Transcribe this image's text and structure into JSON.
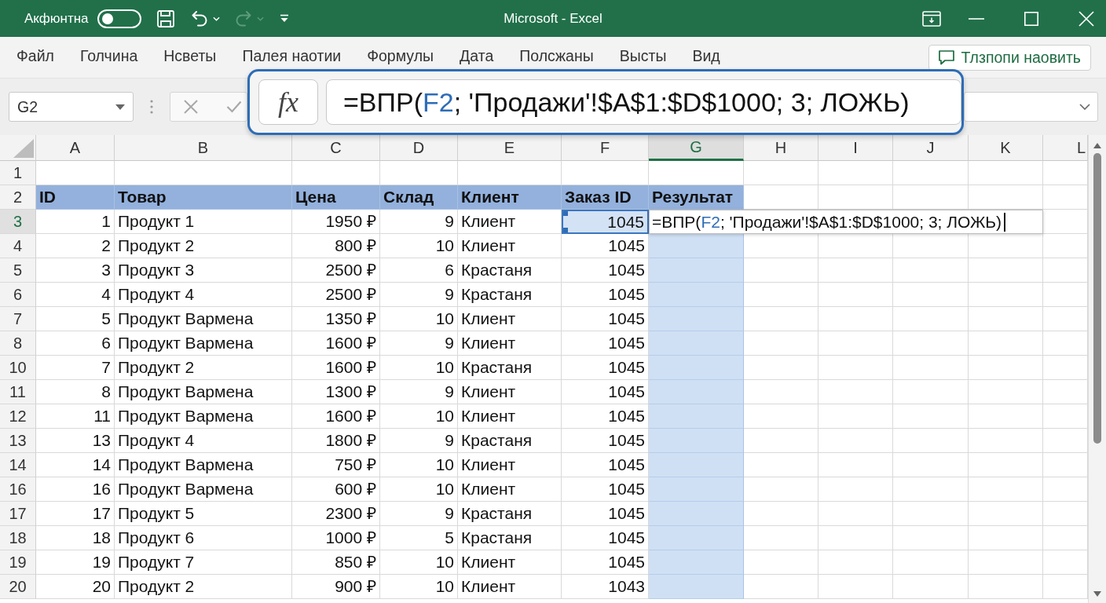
{
  "title_bar": {
    "toggle_label": "Акфюнтна",
    "toggle_on": false,
    "redo_disabled": true,
    "title": "Microsoft - Excel"
  },
  "ribbon_tabs": [
    {
      "label": "Файл",
      "selected": false
    },
    {
      "label": "Голчина",
      "selected": false
    },
    {
      "label": "Нсветы",
      "selected": false
    },
    {
      "label": "Палея наотии",
      "selected": false
    },
    {
      "label": "Формулы",
      "selected": false
    },
    {
      "label": "Дата",
      "selected": false
    },
    {
      "label": "Полсжаны",
      "selected": false
    },
    {
      "label": "Высты",
      "selected": false
    },
    {
      "label": "Вид",
      "selected": false
    }
  ],
  "comment_button": {
    "label": "Тлзпопи наовить"
  },
  "formula_bar": {
    "name_box": "G2",
    "fx_label": "fx",
    "formula": [
      {
        "text": "=ВПР(",
        "kind": "text"
      },
      {
        "text": "F2",
        "kind": "reference"
      },
      {
        "text": "; 'Продажи'!$A$1:$D$1000; 3; ЛОЖЬ)",
        "kind": "text"
      }
    ]
  },
  "sheet": {
    "columns": [
      {
        "label": "A",
        "selected": false
      },
      {
        "label": "B",
        "selected": false
      },
      {
        "label": "C",
        "selected": false
      },
      {
        "label": "D",
        "selected": false
      },
      {
        "label": "E",
        "selected": false
      },
      {
        "label": "F",
        "selected": false
      },
      {
        "label": "G",
        "selected": true
      },
      {
        "label": "H",
        "selected": false
      },
      {
        "label": "I",
        "selected": false
      },
      {
        "label": "J",
        "selected": false
      },
      {
        "label": "K",
        "selected": false
      },
      {
        "label": "L",
        "selected": false
      }
    ],
    "rows": [
      {
        "label": "1",
        "selected": false,
        "kind": "blank"
      },
      {
        "label": "2",
        "selected": false,
        "kind": "header",
        "cells": [
          {
            "text": "ID",
            "referenced": false
          },
          {
            "text": "Товар",
            "referenced": false
          },
          {
            "text": "Цена",
            "referenced": false
          },
          {
            "text": "Склад",
            "referenced": false
          },
          {
            "text": "Клиент",
            "referenced": false
          },
          {
            "text": "Заказ ID",
            "referenced": false
          },
          {
            "text": "Результат",
            "referenced": false
          }
        ]
      },
      {
        "label": "3",
        "selected": true,
        "kind": "data",
        "cells": [
          {
            "text": "1",
            "referenced": false
          },
          {
            "text": "Продукт 1",
            "referenced": false
          },
          {
            "text": "1950 ₽",
            "referenced": false
          },
          {
            "text": "9",
            "referenced": false
          },
          {
            "text": "Клиент",
            "referenced": false
          },
          {
            "text": "1045",
            "referenced": true
          }
        ],
        "editor": {
          "formula": [
            {
              "text": "=ВПР(",
              "kind": "text"
            },
            {
              "text": "F2",
              "kind": "reference"
            },
            {
              "text": "; 'Продажи'!$A$1:$D$1000; 3; ЛОЖЬ)",
              "kind": "text"
            }
          ]
        }
      },
      {
        "label": "4",
        "selected": false,
        "kind": "data",
        "cells": [
          {
            "text": "2",
            "referenced": false
          },
          {
            "text": "Продукт 2",
            "referenced": false
          },
          {
            "text": "800 ₽",
            "referenced": false
          },
          {
            "text": "10",
            "referenced": false
          },
          {
            "text": "Клиент",
            "referenced": false
          },
          {
            "text": "1045",
            "referenced": false
          }
        ]
      },
      {
        "label": "5",
        "selected": false,
        "kind": "data",
        "cells": [
          {
            "text": "3",
            "referenced": false
          },
          {
            "text": "Продукт 3",
            "referenced": false
          },
          {
            "text": "2500 ₽",
            "referenced": false
          },
          {
            "text": "6",
            "referenced": false
          },
          {
            "text": "Крастаня",
            "referenced": false
          },
          {
            "text": "1045",
            "referenced": false
          }
        ]
      },
      {
        "label": "6",
        "selected": false,
        "kind": "data",
        "cells": [
          {
            "text": "4",
            "referenced": false
          },
          {
            "text": "Продукт 4",
            "referenced": false
          },
          {
            "text": "2500 ₽",
            "referenced": false
          },
          {
            "text": "9",
            "referenced": false
          },
          {
            "text": "Крастаня",
            "referenced": false
          },
          {
            "text": "1045",
            "referenced": false
          }
        ]
      },
      {
        "label": "7",
        "selected": false,
        "kind": "data",
        "cells": [
          {
            "text": "5",
            "referenced": false
          },
          {
            "text": "Продукт Вармена",
            "referenced": false
          },
          {
            "text": "1350 ₽",
            "referenced": false
          },
          {
            "text": "10",
            "referenced": false
          },
          {
            "text": "Клиент",
            "referenced": false
          },
          {
            "text": "1045",
            "referenced": false
          }
        ]
      },
      {
        "label": "8",
        "selected": false,
        "kind": "data",
        "cells": [
          {
            "text": "6",
            "referenced": false
          },
          {
            "text": "Продукт Вармена",
            "referenced": false
          },
          {
            "text": "1600 ₽",
            "referenced": false
          },
          {
            "text": "9",
            "referenced": false
          },
          {
            "text": "Клиент",
            "referenced": false
          },
          {
            "text": "1045",
            "referenced": false
          }
        ]
      },
      {
        "label": "10",
        "selected": false,
        "kind": "data",
        "cells": [
          {
            "text": "7",
            "referenced": false
          },
          {
            "text": "Продукт 2",
            "referenced": false
          },
          {
            "text": "1600 ₽",
            "referenced": false
          },
          {
            "text": "10",
            "referenced": false
          },
          {
            "text": "Крастаня",
            "referenced": false
          },
          {
            "text": "1045",
            "referenced": false
          }
        ]
      },
      {
        "label": "11",
        "selected": false,
        "kind": "data",
        "cells": [
          {
            "text": "8",
            "referenced": false
          },
          {
            "text": "Продукт Вармена",
            "referenced": false
          },
          {
            "text": "1300 ₽",
            "referenced": false
          },
          {
            "text": "9",
            "referenced": false
          },
          {
            "text": "Клиент",
            "referenced": false
          },
          {
            "text": "1045",
            "referenced": false
          }
        ]
      },
      {
        "label": "12",
        "selected": false,
        "kind": "data",
        "cells": [
          {
            "text": "11",
            "referenced": false
          },
          {
            "text": "Продукт Вармена",
            "referenced": false
          },
          {
            "text": "1600 ₽",
            "referenced": false
          },
          {
            "text": "10",
            "referenced": false
          },
          {
            "text": "Клиент",
            "referenced": false
          },
          {
            "text": "1045",
            "referenced": false
          }
        ]
      },
      {
        "label": "13",
        "selected": false,
        "kind": "data",
        "cells": [
          {
            "text": "13",
            "referenced": false
          },
          {
            "text": "Продукт 4",
            "referenced": false
          },
          {
            "text": "1800 ₽",
            "referenced": false
          },
          {
            "text": "9",
            "referenced": false
          },
          {
            "text": "Крастаня",
            "referenced": false
          },
          {
            "text": "1045",
            "referenced": false
          }
        ]
      },
      {
        "label": "14",
        "selected": false,
        "kind": "data",
        "cells": [
          {
            "text": "14",
            "referenced": false
          },
          {
            "text": "Продукт Вармена",
            "referenced": false
          },
          {
            "text": "750 ₽",
            "referenced": false
          },
          {
            "text": "10",
            "referenced": false
          },
          {
            "text": "Клиент",
            "referenced": false
          },
          {
            "text": "1045",
            "referenced": false
          }
        ]
      },
      {
        "label": "16",
        "selected": false,
        "kind": "data",
        "cells": [
          {
            "text": "16",
            "referenced": false
          },
          {
            "text": "Продукт Вармена",
            "referenced": false
          },
          {
            "text": "600 ₽",
            "referenced": false
          },
          {
            "text": "10",
            "referenced": false
          },
          {
            "text": "Клиент",
            "referenced": false
          },
          {
            "text": "1045",
            "referenced": false
          }
        ]
      },
      {
        "label": "17",
        "selected": false,
        "kind": "data",
        "cells": [
          {
            "text": "17",
            "referenced": false
          },
          {
            "text": "Продукт 5",
            "referenced": false
          },
          {
            "text": "2300 ₽",
            "referenced": false
          },
          {
            "text": "9",
            "referenced": false
          },
          {
            "text": "Крастаня",
            "referenced": false
          },
          {
            "text": "1045",
            "referenced": false
          }
        ]
      },
      {
        "label": "18",
        "selected": false,
        "kind": "data",
        "cells": [
          {
            "text": "18",
            "referenced": false
          },
          {
            "text": "Продукт 6",
            "referenced": false
          },
          {
            "text": "1000 ₽",
            "referenced": false
          },
          {
            "text": "5",
            "referenced": false
          },
          {
            "text": "Крастаня",
            "referenced": false
          },
          {
            "text": "1045",
            "referenced": false
          }
        ]
      },
      {
        "label": "19",
        "selected": false,
        "kind": "data",
        "cells": [
          {
            "text": "19",
            "referenced": false
          },
          {
            "text": "Продукт 7",
            "referenced": false
          },
          {
            "text": "850 ₽",
            "referenced": false
          },
          {
            "text": "10",
            "referenced": false
          },
          {
            "text": "Клиент",
            "referenced": false
          },
          {
            "text": "1045",
            "referenced": false
          }
        ]
      },
      {
        "label": "20",
        "selected": false,
        "kind": "data",
        "cells": [
          {
            "text": "20",
            "referenced": false
          },
          {
            "text": "Продукт 2",
            "referenced": false
          },
          {
            "text": "900 ₽",
            "referenced": false
          },
          {
            "text": "10",
            "referenced": false
          },
          {
            "text": "Клиент",
            "referenced": false
          },
          {
            "text": "1043",
            "referenced": false
          }
        ]
      }
    ]
  }
}
